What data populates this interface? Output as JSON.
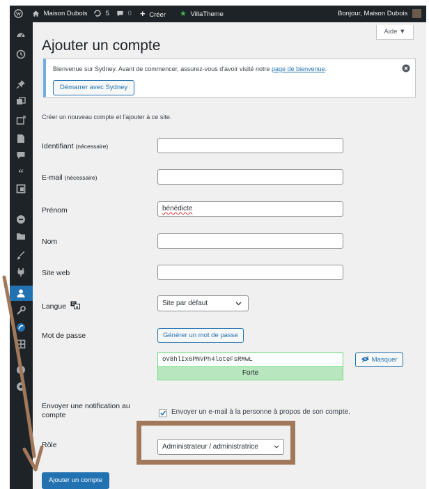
{
  "admin_bar": {
    "site_name": "Maison Dubois",
    "updates_count": "5",
    "comments_count": "0",
    "new_label": "Créer",
    "theme_label": "VillaTheme",
    "greeting": "Bonjour, Maison Dubois"
  },
  "sidebar": {
    "icons": [
      "dashboard-icon",
      "clock-icon",
      "pin-icon",
      "media-icon",
      "page-icon",
      "document-icon",
      "comment-icon",
      "quote-icon",
      "layout-icon",
      "circle-icon",
      "folder-icon",
      "brush-icon",
      "plugin-icon",
      "users-icon",
      "tools-icon",
      "sydney-icon",
      "grid-icon",
      "play-circle-icon",
      "collapse-icon"
    ],
    "active": "users-icon"
  },
  "page": {
    "title": "Ajouter un compte",
    "help_label": "Aide ▼",
    "intro": "Créer un nouveau compte et l'ajouter à ce site."
  },
  "notice": {
    "text_before": "Bienvenue sur Sydney. Avant de commencer, assurez-vous d'avoir visité notre ",
    "link": "page de bienvenue",
    "text_after": ".",
    "button": "Démarrer avec Sydney"
  },
  "form": {
    "username": {
      "label": "Identifiant",
      "note": "(nécessaire)",
      "value": ""
    },
    "email": {
      "label": "E-mail",
      "note": "(nécessaire)",
      "value": ""
    },
    "first_name": {
      "label": "Prénom",
      "value": "bénédicte"
    },
    "last_name": {
      "label": "Nom",
      "value": ""
    },
    "website": {
      "label": "Site web",
      "value": ""
    },
    "language": {
      "label": "Langue",
      "value": "Site par défaut"
    },
    "password": {
      "label": "Mot de passe",
      "generate_button": "Générer un mot de passe",
      "value": "oV8hlIx6PNVPh4loteFsRMwL",
      "hide_button": "Masquer",
      "strength": "Forte"
    },
    "notification": {
      "label": "Envoyer une notification au compte",
      "checked": true,
      "text": "Envoyer un e-mail à la personne à propos de son compte."
    },
    "role": {
      "label": "Rôle",
      "value": "Administrateur / administratrice"
    },
    "submit": "Ajouter un compte"
  },
  "colors": {
    "accent": "#2271b1",
    "admin_bar": "#1d2327",
    "annotation": "#a1785a"
  }
}
